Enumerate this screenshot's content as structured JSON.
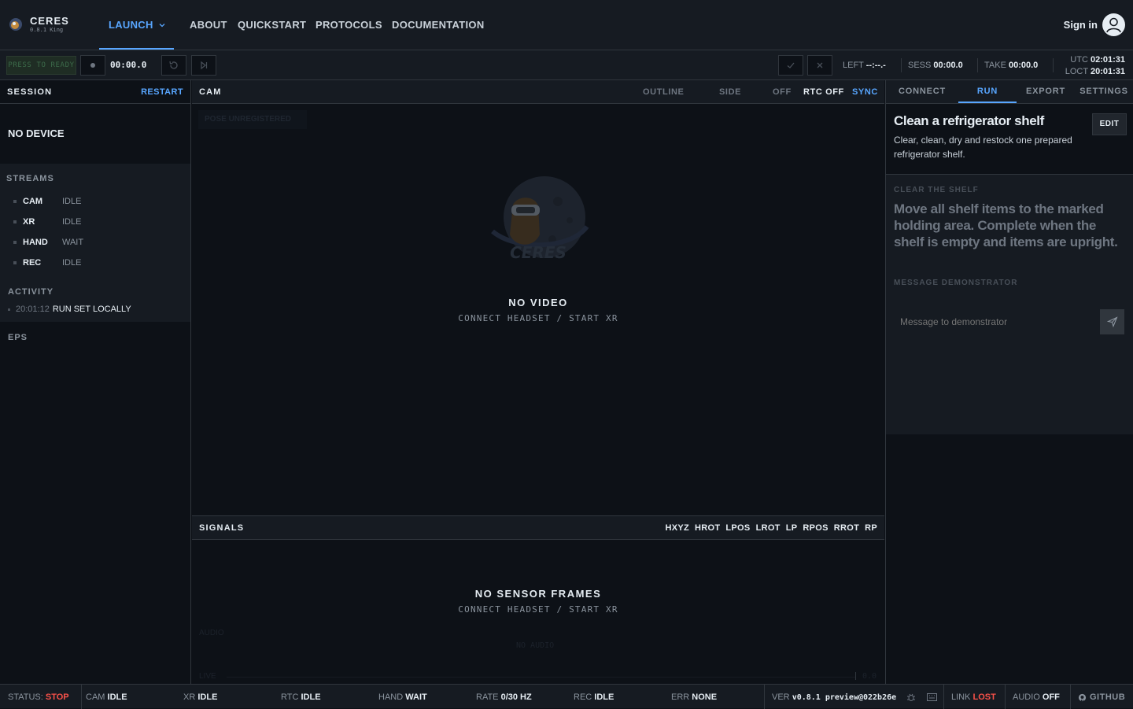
{
  "brand": {
    "name": "CERES",
    "version": "0.8.1 King"
  },
  "nav": {
    "launch": "LAUNCH",
    "about": "ABOUT",
    "quickstart": "QUICKSTART",
    "protocols": "PROTOCOLS",
    "documentation": "DOCUMENTATION",
    "signin": "Sign in"
  },
  "toolbar": {
    "press_to_ready": "PRESS TO READY",
    "timer": "00:00.0",
    "left_label": "LEFT",
    "left_value": "--:--.-",
    "sess_label": "SESS",
    "sess_value": "00:00.0",
    "take_label": "TAKE",
    "take_value": "00:00.0",
    "utc_label": "UTC",
    "utc_value": "02:01:31",
    "loct_label": "LOCT",
    "loct_value": "20:01:31"
  },
  "session": {
    "title": "SESSION",
    "restart": "RESTART",
    "device": "NO DEVICE",
    "streams_label": "STREAMS",
    "streams": [
      {
        "name": "CAM",
        "status": "IDLE"
      },
      {
        "name": "XR",
        "status": "IDLE"
      },
      {
        "name": "HAND",
        "status": "WAIT"
      },
      {
        "name": "REC",
        "status": "IDLE"
      }
    ],
    "activity_label": "ACTIVITY",
    "activity": [
      {
        "time": "20:01:12",
        "text": "RUN SET LOCALLY"
      }
    ],
    "eps_label": "EPS"
  },
  "cam": {
    "title": "CAM",
    "opt_outline": "OUTLINE",
    "opt_side": "SIDE",
    "opt_off": "OFF",
    "rtc": "RTC OFF",
    "sync": "SYNC",
    "pose": "POSE UNREGISTERED",
    "logo_text": "CERES",
    "no_video": "NO VIDEO",
    "hint": "CONNECT HEADSET / START XR"
  },
  "signals": {
    "title": "SIGNALS",
    "tags": [
      "HXYZ",
      "HROT",
      "LPOS",
      "LROT",
      "LP",
      "RPOS",
      "RROT",
      "RP"
    ],
    "no_frames": "NO SENSOR FRAMES",
    "hint": "CONNECT HEADSET / START XR",
    "audio_label": "AUDIO",
    "no_audio": "NO AUDIO",
    "live_label": "LIVE",
    "end_label": "0.0"
  },
  "right": {
    "tabs": [
      "CONNECT",
      "RUN",
      "EXPORT",
      "SETTINGS"
    ],
    "active_tab": "RUN",
    "task_title": "Clean a refrigerator shelf",
    "task_desc": "Clear, clean, dry and restock one prepared refrigerator shelf.",
    "edit": "EDIT",
    "step_label": "CLEAR THE SHELF",
    "step_text": "Move all shelf items to the marked holding area. Complete when the shelf is empty and items are upright.",
    "msg_label": "MESSAGE DEMONSTRATOR",
    "msg_placeholder": "Message to demonstrator"
  },
  "status": {
    "status_label": "STATUS:",
    "status_value": "STOP",
    "cam_label": "CAM",
    "cam_value": "IDLE",
    "xr_label": "XR",
    "xr_value": "IDLE",
    "rtc_label": "RTC",
    "rtc_value": "IDLE",
    "hand_label": "HAND",
    "hand_value": "WAIT",
    "rate_label": "RATE",
    "rate_value": "0/30 HZ",
    "rec_label": "REC",
    "rec_value": "IDLE",
    "err_label": "ERR",
    "err_value": "NONE",
    "ver_label": "VER",
    "ver_value": "v0.8.1 preview@022b26e",
    "link_label": "LINK",
    "link_value": "LOST",
    "audio_label": "AUDIO",
    "audio_value": "OFF",
    "github": "GITHUB"
  },
  "colors": {
    "accent": "#58a6ff",
    "danger": "#f85149",
    "bg": "#0d1117",
    "panel": "#161b22"
  }
}
